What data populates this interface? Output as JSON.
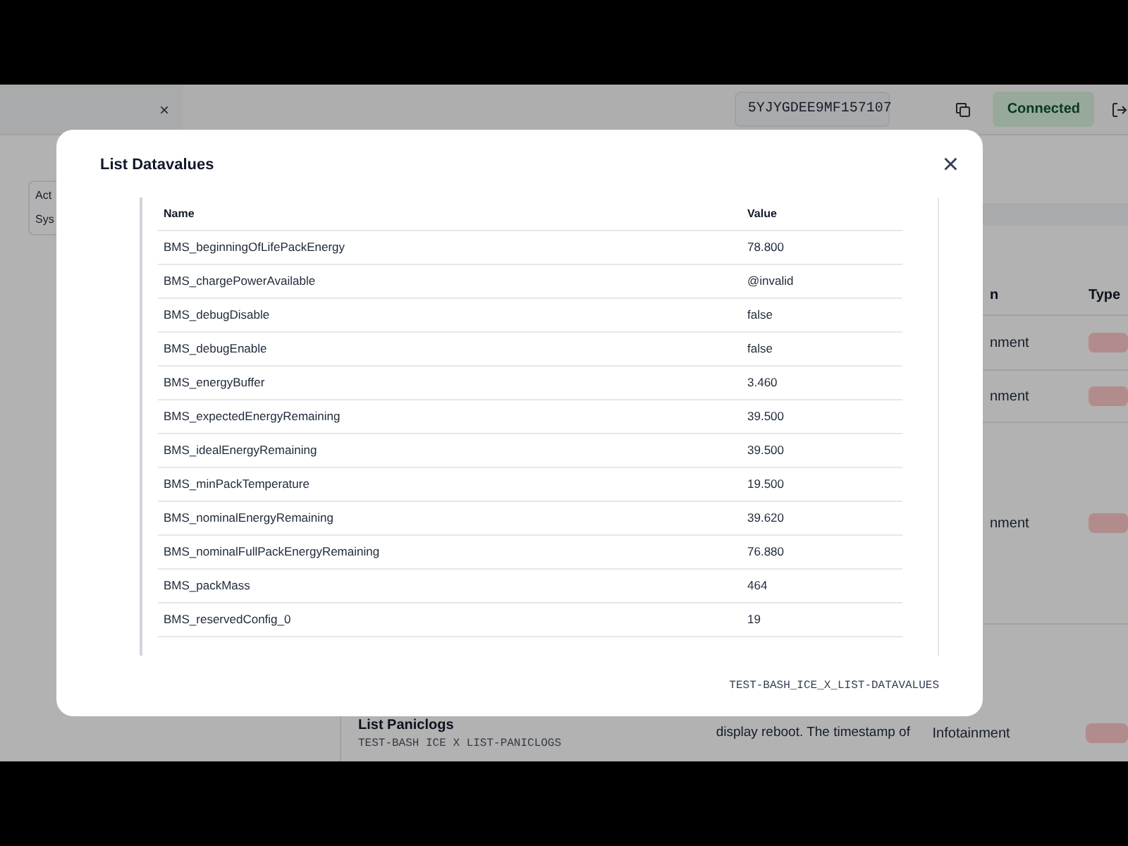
{
  "top_bar": {
    "tab_close": "×",
    "vin": "5YJYGDEE9MF157107",
    "status": "Connected"
  },
  "sidebar": {
    "items": [
      "Act",
      "Sys"
    ]
  },
  "table": {
    "columns": {
      "area": "n",
      "type": "Type"
    },
    "rows": [
      {
        "area": "nment"
      },
      {
        "area": "nment"
      },
      {
        "area": "nment"
      },
      {
        "title": "List Paniclogs",
        "code": "TEST-BASH ICE X LIST-PANICLOGS",
        "description": "display reboot. The timestamp of",
        "area": "Infotainment"
      }
    ]
  },
  "dialog": {
    "title": "List Datavalues",
    "close": "×",
    "columns": [
      "Name",
      "Value"
    ],
    "rows": [
      {
        "name": "BMS_beginningOfLifePackEnergy",
        "value": "78.800"
      },
      {
        "name": "BMS_chargePowerAvailable",
        "value": "@invalid"
      },
      {
        "name": "BMS_debugDisable",
        "value": "false"
      },
      {
        "name": "BMS_debugEnable",
        "value": "false"
      },
      {
        "name": "BMS_energyBuffer",
        "value": "3.460"
      },
      {
        "name": "BMS_expectedEnergyRemaining",
        "value": "39.500"
      },
      {
        "name": "BMS_idealEnergyRemaining",
        "value": "39.500"
      },
      {
        "name": "BMS_minPackTemperature",
        "value": "19.500"
      },
      {
        "name": "BMS_nominalEnergyRemaining",
        "value": "39.620"
      },
      {
        "name": "BMS_nominalFullPackEnergyRemaining",
        "value": "76.880"
      },
      {
        "name": "BMS_packMass",
        "value": "464"
      },
      {
        "name": "BMS_reservedConfig_0",
        "value": "19"
      }
    ],
    "footer": "TEST-BASH_ICE_X_LIST-DATAVALUES"
  }
}
